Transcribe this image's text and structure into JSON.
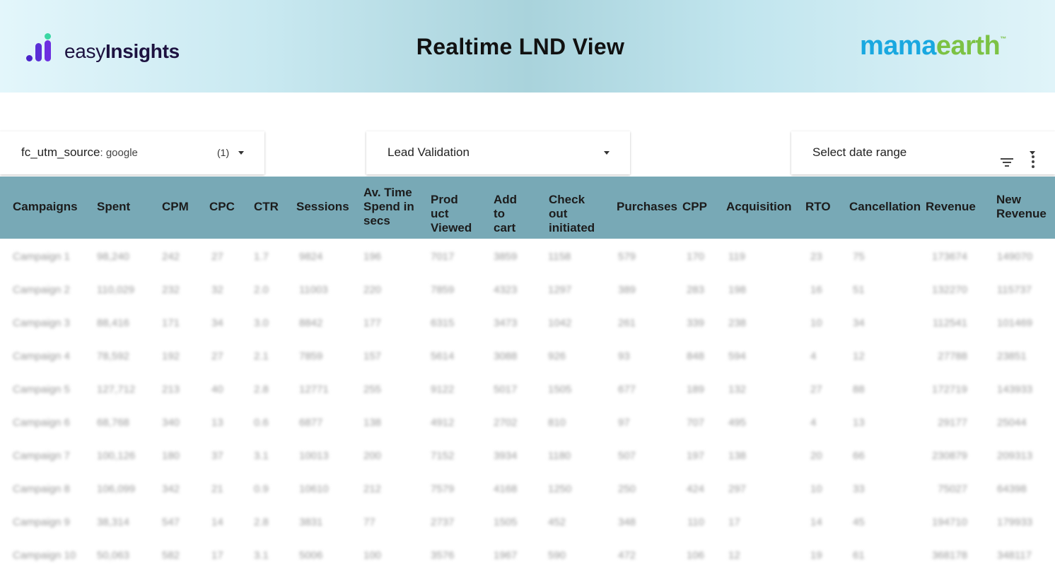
{
  "header": {
    "logo_left_prefix": "easy",
    "logo_left_bold": "Insights",
    "title": "Realtime LND View",
    "logo_right_a": "mama",
    "logo_right_b": "earth",
    "logo_right_tm": "™"
  },
  "filters": {
    "source_key": "fc_utm_source",
    "source_value": ": google",
    "source_count": "(1)",
    "validation": "Lead Validation",
    "date_placeholder": "Select date range"
  },
  "table": {
    "columns": [
      "Campaigns",
      "Spent",
      "CPM",
      "CPC",
      "CTR",
      "Sessions",
      "Av. Time Spend in secs",
      "Prod uct Viewed",
      "Add to cart",
      "Check out initiated",
      "Purchases",
      "CPP",
      "Acquisition",
      "RTO",
      "Cancellation",
      "Revenue",
      "New Revenue"
    ],
    "rows": [
      [
        "Campaign 1",
        "98,240",
        "242",
        "27",
        "1.7",
        "9824",
        "196",
        "7017",
        "3859",
        "1158",
        "579",
        "170",
        "119",
        "23",
        "75",
        "173674",
        "149070"
      ],
      [
        "Campaign 2",
        "110,029",
        "232",
        "32",
        "2.0",
        "11003",
        "220",
        "7859",
        "4323",
        "1297",
        "389",
        "283",
        "198",
        "16",
        "51",
        "132270",
        "115737"
      ],
      [
        "Campaign 3",
        "88,416",
        "171",
        "34",
        "3.0",
        "8842",
        "177",
        "6315",
        "3473",
        "1042",
        "261",
        "339",
        "238",
        "10",
        "34",
        "112541",
        "101469"
      ],
      [
        "Campaign 4",
        "78,592",
        "192",
        "27",
        "2.1",
        "7859",
        "157",
        "5614",
        "3088",
        "926",
        "93",
        "848",
        "594",
        "4",
        "12",
        "27788",
        "23851"
      ],
      [
        "Campaign 5",
        "127,712",
        "213",
        "40",
        "2.8",
        "12771",
        "255",
        "9122",
        "5017",
        "1505",
        "677",
        "189",
        "132",
        "27",
        "88",
        "172719",
        "143933"
      ],
      [
        "Campaign 6",
        "68,768",
        "340",
        "13",
        "0.6",
        "6877",
        "138",
        "4912",
        "2702",
        "810",
        "97",
        "707",
        "495",
        "4",
        "13",
        "29177",
        "25044"
      ],
      [
        "Campaign 7",
        "100,126",
        "180",
        "37",
        "3.1",
        "10013",
        "200",
        "7152",
        "3934",
        "1180",
        "507",
        "197",
        "138",
        "20",
        "66",
        "230879",
        "209313"
      ],
      [
        "Campaign 8",
        "106,099",
        "342",
        "21",
        "0.9",
        "10610",
        "212",
        "7579",
        "4168",
        "1250",
        "250",
        "424",
        "297",
        "10",
        "33",
        "75027",
        "64398"
      ],
      [
        "Campaign 9",
        "38,314",
        "547",
        "14",
        "2.8",
        "3831",
        "77",
        "2737",
        "1505",
        "452",
        "348",
        "110",
        "17",
        "14",
        "45",
        "194710",
        "179933"
      ],
      [
        "Campaign 10",
        "50,063",
        "582",
        "17",
        "3.1",
        "5006",
        "100",
        "3576",
        "1967",
        "590",
        "472",
        "106",
        "12",
        "19",
        "61",
        "368178",
        "348117"
      ]
    ]
  }
}
